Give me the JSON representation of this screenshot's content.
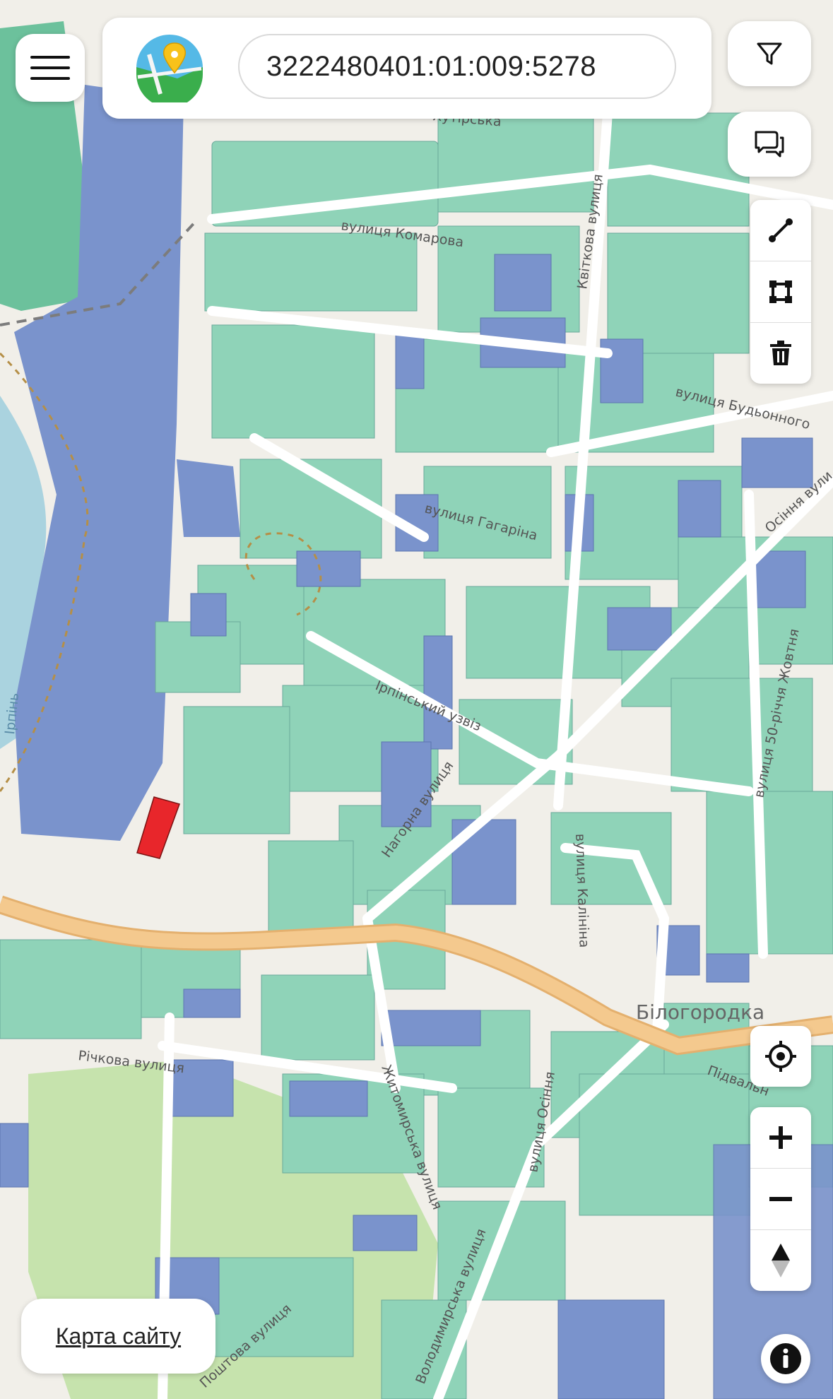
{
  "search": {
    "value": "3222480401:01:009:5278"
  },
  "footer": {
    "sitemap_label": "Карта сайту"
  },
  "map_labels": {
    "hutsulska": "Хутірська",
    "komarova": "вулиця Комарова",
    "kvitkova": "Квіткова вулиця",
    "budonnoho": "вулиця Будьонного",
    "haharina": "вулиця Гагаріна",
    "osinnia_top": "Осіння вули",
    "irpinskyi": "Ірпінський узвіз",
    "nahorna": "Нагорна вулиця",
    "kalinina": "вулиця Калініна",
    "50_richcha": "вулиця 50-річчя Жовтня",
    "irpin": "Ірпінь",
    "bilohorodka": "Білогородка",
    "richkova": "Річкова вулиця",
    "zhytomyrska": "Житомирська вулиця",
    "osinnia": "вулиця Осіння",
    "pidvalna": "Підвальн",
    "volodymyrska": "Володимирська вулиця",
    "poshtova": "Поштова вулиця"
  },
  "colors": {
    "parcel_green": "#8fd3b8",
    "parcel_blue": "#7a93cc",
    "parcel_dark_green": "#55b98e",
    "selected_parcel": "#e8262b",
    "main_road": "#f4c98e",
    "river": "#aad3df",
    "park": "#b6dca0"
  },
  "icons": {
    "menu": "hamburger-icon",
    "logo": "map-pin-logo-icon",
    "filter": "filter-icon",
    "chat": "chat-icon",
    "line_tool": "measure-line-icon",
    "polygon_tool": "polygon-icon",
    "delete": "trash-icon",
    "locate": "locate-icon",
    "zoom_in": "plus-icon",
    "zoom_out": "minus-icon",
    "compass": "compass-icon",
    "info": "info-icon"
  }
}
